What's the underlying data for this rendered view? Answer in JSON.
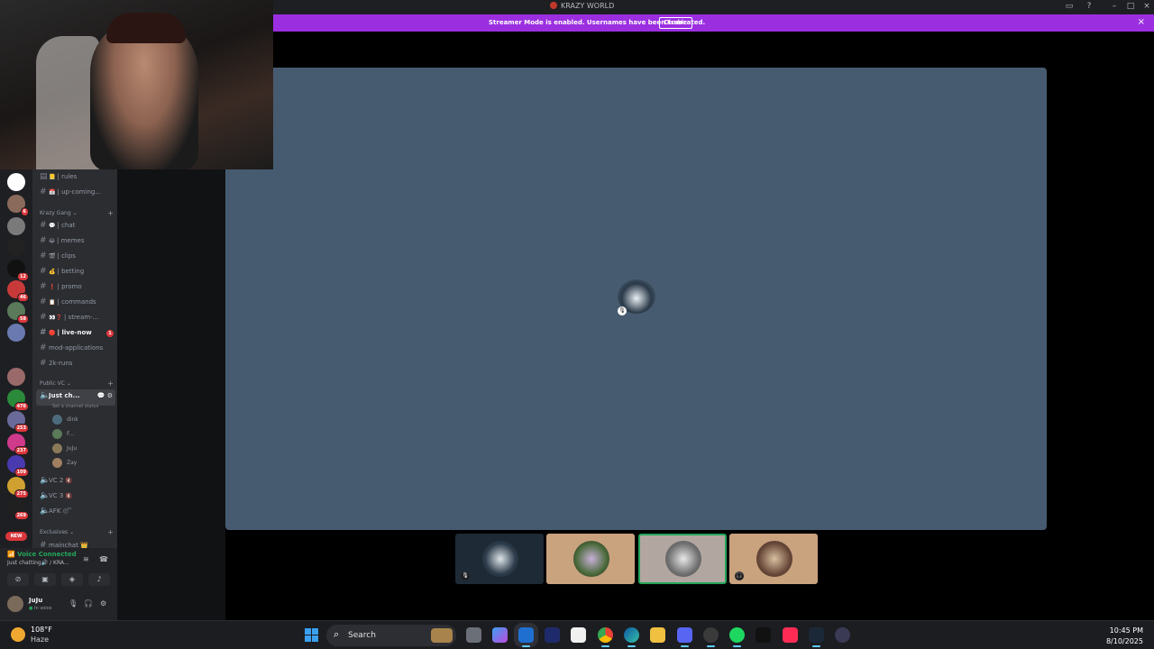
{
  "window": {
    "title": "KRAZY WORLD"
  },
  "banner": {
    "message": "Streamer Mode is enabled. Usernames have been truncated.",
    "disable_label": "Disable"
  },
  "guilds": [
    {
      "badge": ""
    },
    {
      "badge": "6"
    },
    {
      "badge": ""
    },
    {
      "badge": ""
    },
    {
      "badge": "12"
    },
    {
      "badge": "46"
    },
    {
      "badge": "58"
    },
    {
      "badge": ""
    },
    {
      "badge": ""
    },
    {
      "badge": "476"
    },
    {
      "badge": "253"
    },
    {
      "badge": "237"
    },
    {
      "badge": "109"
    },
    {
      "badge": "275"
    },
    {
      "badge": "269"
    }
  ],
  "guild_new_label": "NEW",
  "channels_top": [
    {
      "emoji": "📒",
      "label": "rules"
    },
    {
      "emoji": "📅",
      "label": "up-coming..."
    }
  ],
  "category_krazy_gang": "Krazy Gang",
  "channels_krazy": [
    {
      "emoji": "💬",
      "label": "chat"
    },
    {
      "emoji": "😂",
      "label": "memes"
    },
    {
      "emoji": "🎬",
      "label": "clips"
    },
    {
      "emoji": "💰",
      "label": "betting"
    },
    {
      "emoji": "❗",
      "label": "promo"
    },
    {
      "emoji": "📋",
      "label": "commands"
    },
    {
      "emoji": "👀❓",
      "label": "stream-..."
    },
    {
      "emoji": "🔴",
      "label": "live-now",
      "unread": "1"
    },
    {
      "emoji": "",
      "label": "mod-applications"
    },
    {
      "emoji": "",
      "label": "2k-runs"
    }
  ],
  "category_public_vc": "Public VC",
  "active_vc": {
    "name": "Just ch...",
    "status": "Set a channel status"
  },
  "vc_members": [
    {
      "name": "dink",
      "color": "#4d6b7c"
    },
    {
      "name": "F...",
      "color": "#5a7a5a"
    },
    {
      "name": "JuJu",
      "color": "#8a7a5a"
    },
    {
      "name": "Zay",
      "color": "#a08060"
    }
  ],
  "other_vcs": [
    {
      "name": "VC 2",
      "emoji": "🔇"
    },
    {
      "name": "VC 3",
      "emoji": "🔇"
    },
    {
      "name": "AFK",
      "emoji": "😴"
    }
  ],
  "category_exclusives": "Exclusives",
  "exclusive_partial": "mainchat 👑",
  "voice": {
    "connected": "Voice Connected",
    "channel": "Just chatting🔊 / KRA..."
  },
  "user": {
    "name": "JuJu",
    "status": "In voice"
  },
  "taskbar": {
    "temperature": "108°F",
    "condition": "Haze",
    "search_label": "Search",
    "time": "10:45 PM",
    "date": "8/10/2025"
  },
  "colors": {
    "accent": "#9b2fe0",
    "voice_green": "#23a55a",
    "stage": "#475b70",
    "unread_red": "#da373c"
  }
}
